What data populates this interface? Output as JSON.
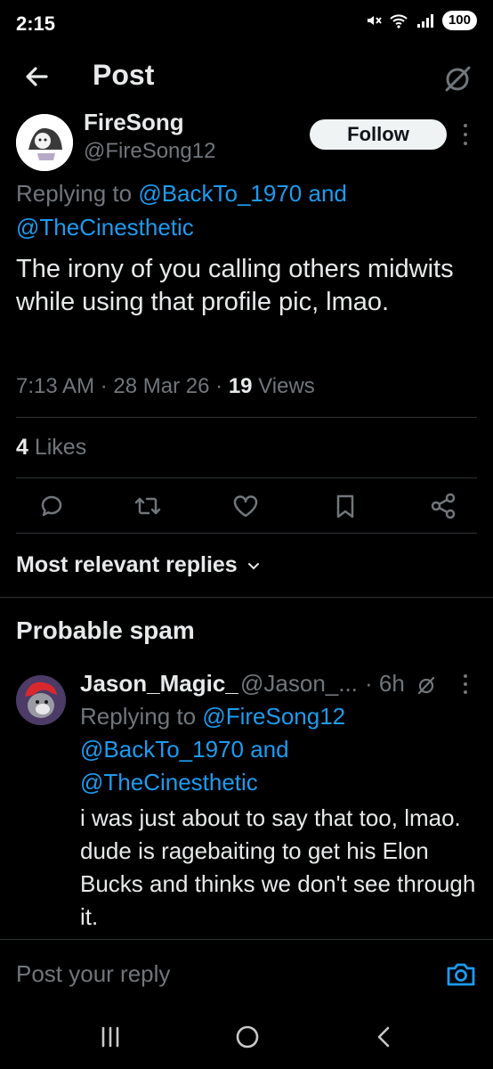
{
  "status_bar": {
    "time": "2:15",
    "battery": "100"
  },
  "header": {
    "title": "Post"
  },
  "tweet": {
    "author": {
      "display_name": "FireSong",
      "handle": "@FireSong12"
    },
    "follow_label": "Follow",
    "replying_to_prefix": "Replying to ",
    "replying_to_user1": "@BackTo_1970",
    "replying_to_and": " and",
    "replying_to_user2": "@TheCinesthetic",
    "text": "The irony of you calling others midwits while using that profile pic, lmao.",
    "time": "7:13 AM",
    "date": "28 Mar 26",
    "views_count": "19",
    "views_label": " Views",
    "likes_count": "4",
    "likes_label": " Likes"
  },
  "sort_label": "Most relevant replies",
  "spam_section_title": "Probable spam",
  "reply": {
    "display_name": "Jason_Magic_",
    "handle": "@Jason_...",
    "time": "· 6h",
    "replying_to_prefix": "Replying to ",
    "replying_to_user1": "@FireSong12",
    "replying_to_user2": "@BackTo_1970",
    "replying_to_and": " and",
    "replying_to_user3": "@TheCinesthetic",
    "text": "i was just about to say that too, lmao. dude is ragebaiting to get his Elon Bucks and thinks we don't see through it."
  },
  "composer": {
    "placeholder": "Post your reply"
  },
  "icons": {
    "back": "arrow-left-icon",
    "grok": "grok-icon",
    "reply": "comment-icon",
    "repost": "repost-icon",
    "like": "heart-icon",
    "bookmark": "bookmark-icon",
    "share": "share-icon",
    "camera": "camera-icon"
  },
  "colors": {
    "accent": "#1d9bf0",
    "muted": "#71767b",
    "text": "#e7e9ea",
    "background": "#000000"
  }
}
